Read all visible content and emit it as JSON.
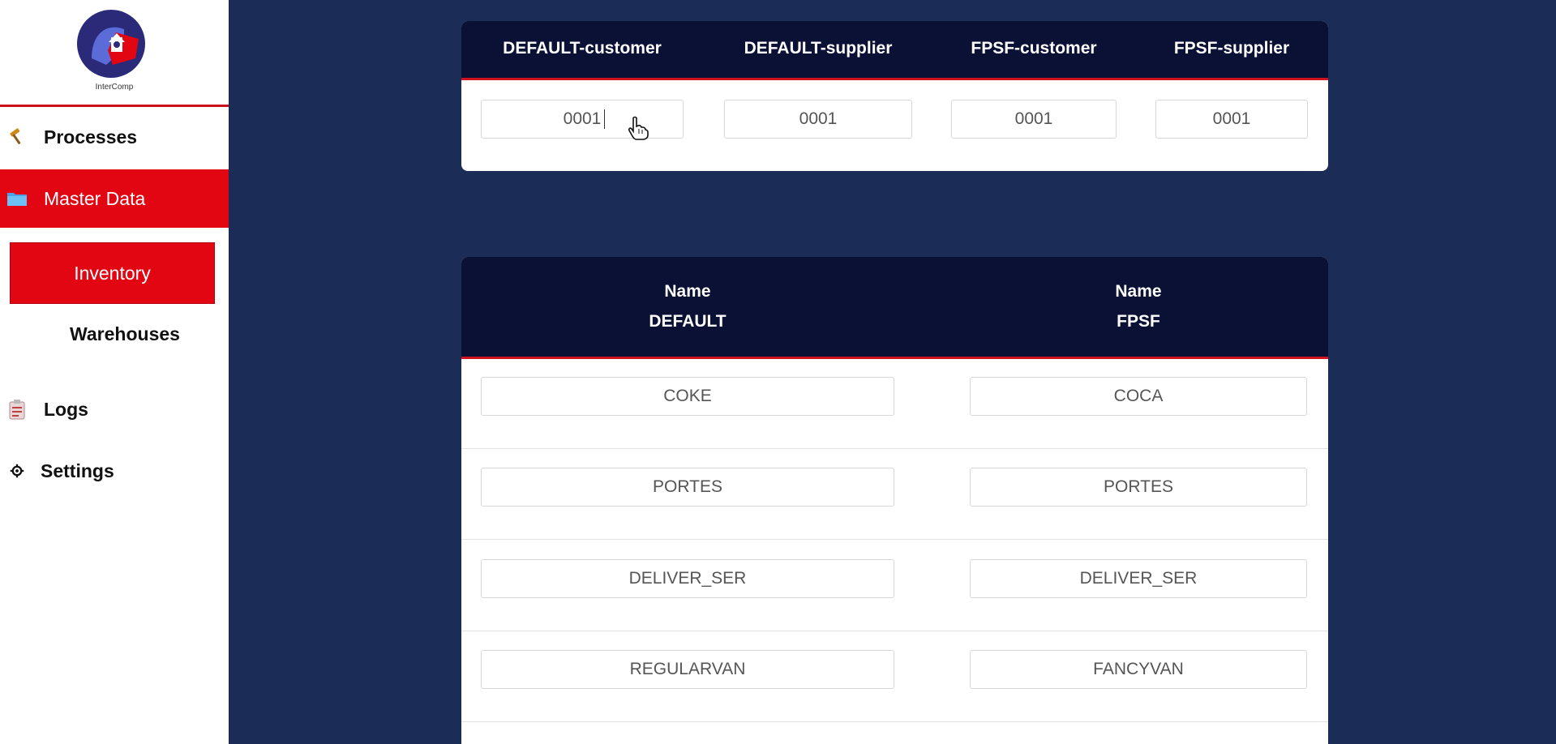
{
  "sidebar": {
    "logo_text": "InterComp",
    "items": [
      {
        "label": "Processes",
        "icon": "hammer-icon"
      },
      {
        "label": "Master Data",
        "icon": "folder-icon"
      },
      {
        "label": "Logs",
        "icon": "clipboard-icon"
      },
      {
        "label": "Settings",
        "icon": "gear-icon"
      }
    ],
    "master_data_sub": [
      {
        "label": "Inventory"
      },
      {
        "label": "Warehouses"
      }
    ],
    "colors": {
      "active": "#e20613",
      "accent_line": "#c9101c"
    }
  },
  "top_card": {
    "headers": [
      "DEFAULT-customer",
      "DEFAULT-supplier",
      "FPSF-customer",
      "FPSF-supplier"
    ],
    "values": [
      "0001",
      "0001",
      "0001",
      "0001"
    ]
  },
  "names_card": {
    "headers": [
      {
        "line1": "Name",
        "line2": "DEFAULT"
      },
      {
        "line1": "Name",
        "line2": "FPSF"
      }
    ],
    "rows": [
      {
        "default": "COKE",
        "fpsf": "COCA"
      },
      {
        "default": "PORTES",
        "fpsf": "PORTES"
      },
      {
        "default": "DELIVER_SER",
        "fpsf": "DELIVER_SER"
      },
      {
        "default": "REGULARVAN",
        "fpsf": "FANCYVAN"
      }
    ]
  },
  "theme": {
    "background": "#1b2d57",
    "header_bg": "#0a1135"
  }
}
